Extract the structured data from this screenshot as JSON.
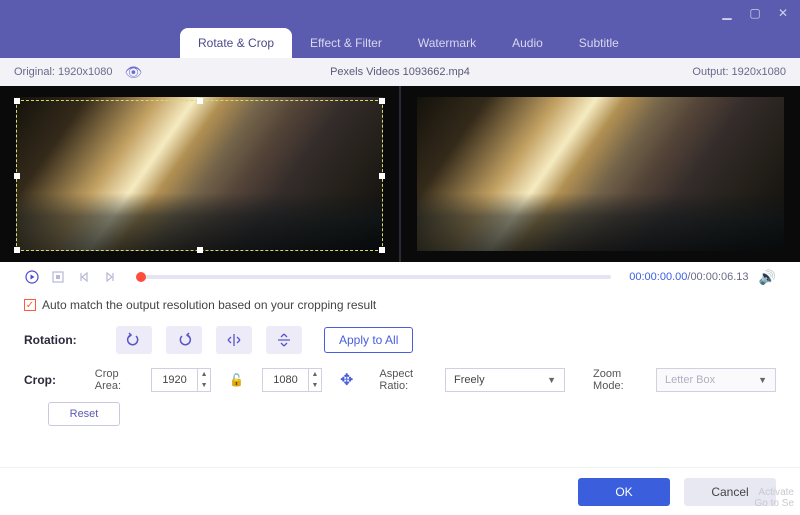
{
  "window": {
    "minimize": "▁",
    "maximize": "▢",
    "close": "✕"
  },
  "tabs": {
    "rotate_crop": "Rotate & Crop",
    "effect_filter": "Effect & Filter",
    "watermark": "Watermark",
    "audio": "Audio",
    "subtitle": "Subtitle"
  },
  "info": {
    "original_label": "Original:  1920x1080",
    "filename": "Pexels Videos 1093662.mp4",
    "output_label": "Output:  1920x1080"
  },
  "playbar": {
    "current": "00:00:00.00",
    "sep": "/",
    "duration": "00:00:06.13"
  },
  "auto_match": {
    "checked": true,
    "label": "Auto match the output resolution based on your cropping result"
  },
  "rotation": {
    "label": "Rotation:",
    "apply_all": "Apply to All"
  },
  "crop": {
    "label": "Crop:",
    "area_label": "Crop Area:",
    "width": "1920",
    "height": "1080",
    "aspect_label": "Aspect Ratio:",
    "aspect_value": "Freely",
    "zoom_label": "Zoom Mode:",
    "zoom_value": "Letter Box"
  },
  "buttons": {
    "reset": "Reset",
    "ok": "OK",
    "cancel": "Cancel"
  },
  "watermark_text": {
    "l1": "Activate",
    "l2": "Go to Se"
  }
}
